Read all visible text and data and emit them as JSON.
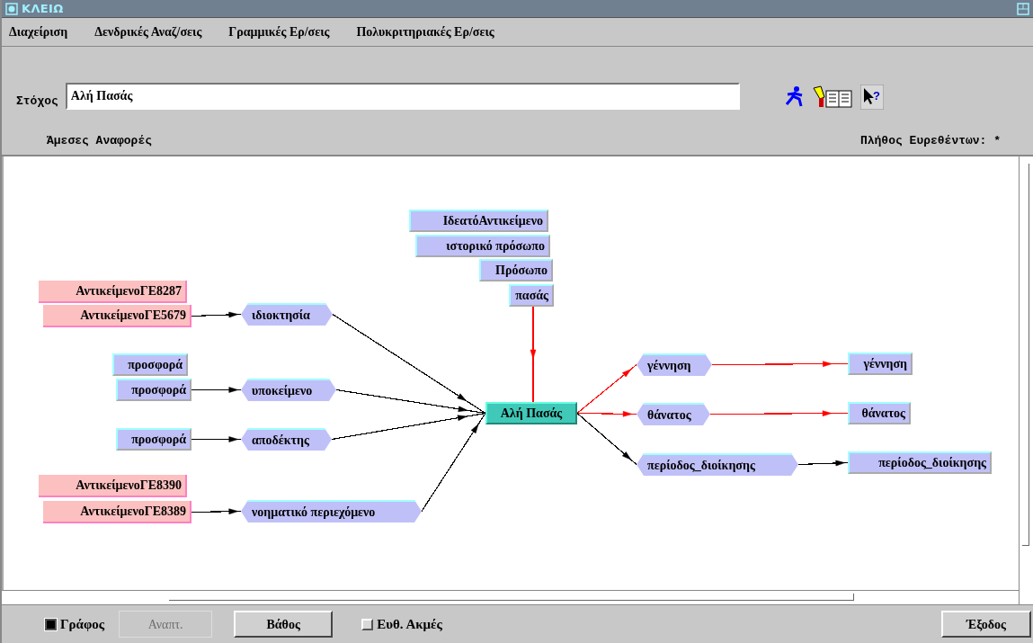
{
  "window": {
    "title": "ΚΛΕΙΩ"
  },
  "menu": [
    {
      "label": "Διαχείριση"
    },
    {
      "label": "Δενδρικές Αναζ/σεις"
    },
    {
      "label": "Γραμμικές Ερ/σεις"
    },
    {
      "label": "Πολυκριτηριακές Ερ/σεις"
    }
  ],
  "target": {
    "label": "Στόχος",
    "value": "Αλή Πασάς"
  },
  "toolbar": {
    "help_glyph": "?"
  },
  "section_title": "Άμεσες Αναφορές",
  "count_label": "Πλήθος Ευρεθέντων: *",
  "graph": {
    "nodes": [
      {
        "label": "ΙδεατόΑντικείμενο",
        "kind": "class"
      },
      {
        "label": "ιστορικό πρόσωπο",
        "kind": "class"
      },
      {
        "label": "Πρόσωπο",
        "kind": "class"
      },
      {
        "label": "πασάς",
        "kind": "class"
      },
      {
        "label": "ΑντικείμενοΓΕ8287",
        "kind": "entity"
      },
      {
        "label": "ΑντικείμενοΓΕ5679",
        "kind": "entity"
      },
      {
        "label": "ιδιοκτησία",
        "kind": "relation"
      },
      {
        "label": "προσφορά",
        "kind": "class"
      },
      {
        "label": "προσφορά",
        "kind": "class"
      },
      {
        "label": "υποκείμενο",
        "kind": "relation"
      },
      {
        "label": "προσφορά",
        "kind": "class"
      },
      {
        "label": "αποδέκτης",
        "kind": "relation"
      },
      {
        "label": "ΑντικείμενοΓΕ8390",
        "kind": "entity"
      },
      {
        "label": "ΑντικείμενοΓΕ8389",
        "kind": "entity"
      },
      {
        "label": "νοηματικό περιεχόμενο",
        "kind": "relation"
      },
      {
        "label": "Αλή Πασάς",
        "kind": "focus"
      },
      {
        "label": "γέννηση",
        "kind": "relation"
      },
      {
        "label": "θάνατος",
        "kind": "relation"
      },
      {
        "label": "περίοδος_διοίκησης",
        "kind": "relation"
      },
      {
        "label": "γέννηση",
        "kind": "class"
      },
      {
        "label": "θάνατος",
        "kind": "class"
      },
      {
        "label": "περίοδος_διοίκησης",
        "kind": "class"
      }
    ],
    "edges": [
      {
        "color": "#000000"
      },
      {
        "color": "#000000"
      },
      {
        "color": "#000000"
      },
      {
        "color": "#000000"
      },
      {
        "color": "#000000"
      },
      {
        "color": "#000000"
      },
      {
        "color": "#000000"
      },
      {
        "color": "#000000"
      },
      {
        "color": "#ff0000"
      },
      {
        "color": "#ff0000"
      },
      {
        "color": "#ff0000"
      },
      {
        "color": "#000000"
      },
      {
        "color": "#ff0000"
      },
      {
        "color": "#ff0000"
      },
      {
        "color": "#000000"
      }
    ]
  },
  "bottom_bar": {
    "graph_checkbox": {
      "label": "Γράφος",
      "checked": true
    },
    "expand_button": {
      "label": "Αναπτ.",
      "disabled": true
    },
    "depth_button": {
      "label": "Βάθος",
      "disabled": false
    },
    "direct_edges_checkbox": {
      "label": "Ευθ. Ακμές",
      "checked": false
    },
    "exit_button": {
      "label": "Έξοδος",
      "disabled": false
    }
  }
}
